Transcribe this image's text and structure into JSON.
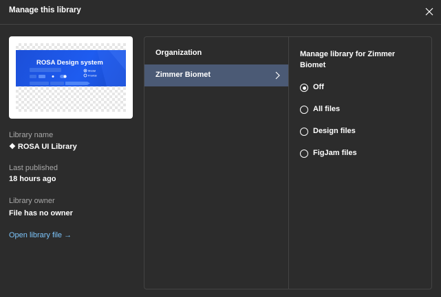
{
  "header": {
    "title": "Manage this library"
  },
  "thumbnail": {
    "title": "ROSA Design system",
    "mock_texts": [
      "Modal",
      "Frontal"
    ]
  },
  "library": {
    "name_label": "Library name",
    "name_value": "❖ ROSA UI Library",
    "published_label": "Last published",
    "published_value": "18 hours ago",
    "owner_label": "Library owner",
    "owner_value": "File has no owner",
    "open_link": "Open library file →"
  },
  "organization": {
    "heading": "Organization",
    "items": [
      {
        "label": "Zimmer Biomet",
        "selected": true
      }
    ]
  },
  "manage": {
    "heading": "Manage library for Zimmer Biomet",
    "options": [
      {
        "label": "Off",
        "checked": true
      },
      {
        "label": "All files",
        "checked": false
      },
      {
        "label": "Design files",
        "checked": false
      },
      {
        "label": "FigJam files",
        "checked": false
      }
    ]
  },
  "colors": {
    "background": "#2c2c2c",
    "selected_row": "#4b5a75",
    "link": "#7cc4fa",
    "cover_blue": "#1e5cf0"
  },
  "icons": {
    "close": "close-icon",
    "chevron": "chevron-right-icon"
  }
}
